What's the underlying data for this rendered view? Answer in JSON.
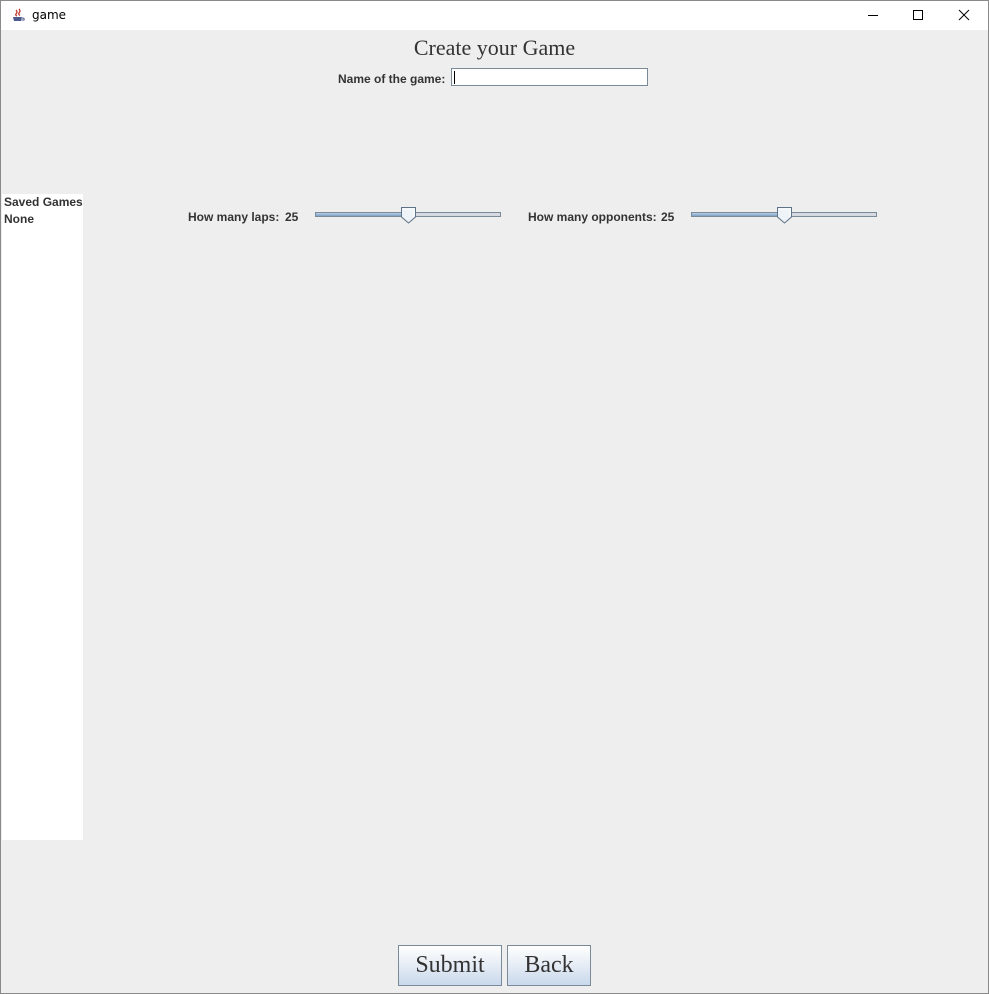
{
  "window": {
    "title": "game"
  },
  "page": {
    "heading": "Create your Game"
  },
  "name_field": {
    "label": "Name of the game:",
    "value": ""
  },
  "saved_games": {
    "title": "Saved Games",
    "items": [
      "None"
    ]
  },
  "sliders": [
    {
      "label": "How many laps:",
      "value": "25",
      "level_fraction": 0.5
    },
    {
      "label": "How many opponents:",
      "value": "25",
      "level_fraction": 0.5
    }
  ],
  "buttons": {
    "submit": "Submit",
    "back": "Back"
  },
  "colors": {
    "window_background": "#eeeeee",
    "slider_fill": "#9ab8d8",
    "button_gradient_bottom": "#c9d9ec"
  },
  "icons": {
    "app": "java-cup-icon",
    "minimize": "minimize-icon",
    "maximize": "maximize-icon",
    "close": "close-icon",
    "slider_thumb": "slider-thumb-icon"
  }
}
